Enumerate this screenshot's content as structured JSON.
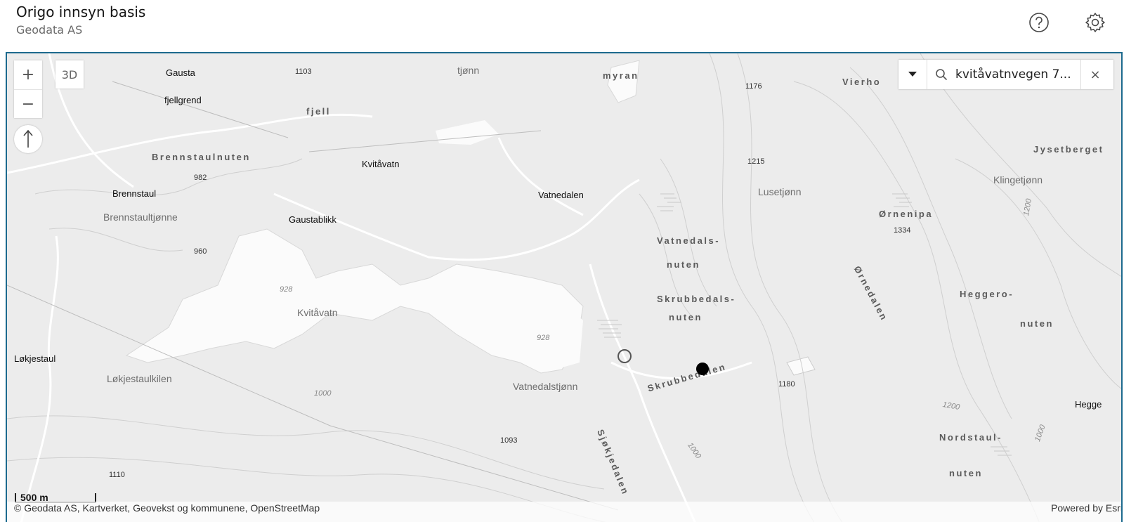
{
  "header": {
    "title": "Origo innsyn basis",
    "subtitle": "Geodata AS"
  },
  "map_controls": {
    "zoom_in": "+",
    "zoom_out": "−",
    "view_3d": "3D"
  },
  "search": {
    "value": "kvitåvatnvegen 7...",
    "clear": "×"
  },
  "scalebar": "500 m",
  "attribution": {
    "text": "© Geodata AS, Kartverket, Geovekst og kommunene, OpenStreetMap",
    "powered_by": "Powered by Esri"
  },
  "labels": {
    "gausta": "Gausta",
    "fjellgrend": "fjellgrend",
    "e1103": "1103",
    "tjonn": "tjønn",
    "myran": "myran",
    "fjell": "fjell",
    "e1176": "1176",
    "vierho": "Vierho",
    "jysetberget": "Jysetberget",
    "brennstaulnuten": "Brennstaulnuten",
    "e982": "982",
    "kvitavatn_top": "Kvitåvatn",
    "e1215": "1215",
    "klingetjonn": "Klingetjønn",
    "brennstaul": "Brennstaul",
    "vatnedalen": "Vatnedalen",
    "lusetjonn": "Lusetjønn",
    "brennstaultjonne": "Brennstaultjønne",
    "gaustablikk": "Gaustablikk",
    "ornenipa": "Ørnenipa",
    "e1334": "1334",
    "e960": "960",
    "vatnedals": "Vatnedals-",
    "nuten1": "nuten",
    "ornedalen": "Ørnedalen",
    "e928a": "928",
    "kvitavatn_lake": "Kvitåvatn",
    "skrubbedals": "Skrubbedals-",
    "nuten2": "nuten",
    "heggero": "Heggero-",
    "nuten3": "nuten",
    "e928b": "928",
    "lokjestaul": "Løkjestaul",
    "lokjestaulkilen": "Løkjestaulkilen",
    "skrubbedalen": "Skrubbedalen",
    "e1180": "1180",
    "vatnedalstjonn": "Vatnedalstjønn",
    "e1000": "1000",
    "hegge": "Hegge",
    "e1093": "1093",
    "sjokjedalen": "Sjøkjedalen",
    "nordstaul": "Nordstaul-",
    "nuten4": "nuten",
    "e1110": "1110",
    "e1200a": "1200",
    "e1200b": "1200",
    "e1000b": "1000",
    "e1000c": "1000"
  }
}
